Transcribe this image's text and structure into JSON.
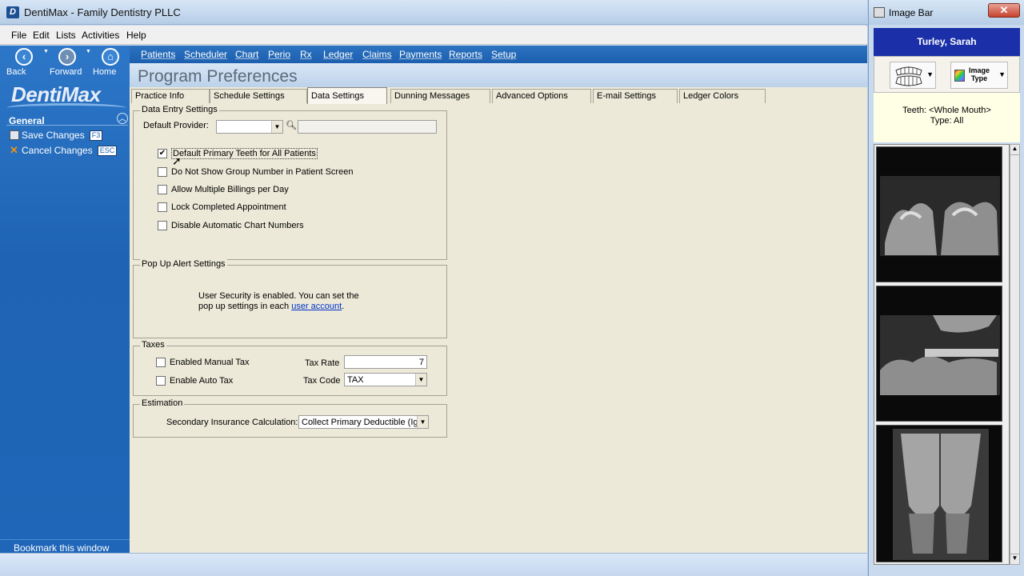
{
  "window": {
    "title": "DentiMax - Family Dentistry PLLC",
    "icon_letter": "D"
  },
  "menu": [
    "File",
    "Edit",
    "Lists",
    "Activities",
    "Help"
  ],
  "navbuttons": {
    "back": "Back",
    "forward": "Forward",
    "home": "Home"
  },
  "logo": "DentiMax",
  "sidebar": {
    "section": "General",
    "save_label": "Save Changes",
    "save_key": "F3",
    "cancel_label": "Cancel Changes",
    "cancel_key": "ESC",
    "bookmark": "Bookmark this window"
  },
  "modules": [
    "Patients",
    "Scheduler",
    "Chart",
    "Perio",
    "Rx",
    "Ledger",
    "Claims",
    "Payments",
    "Reports",
    "Setup"
  ],
  "page_title": "Program Preferences",
  "tabs": [
    "Practice Info",
    "Schedule Settings",
    "Data Settings",
    "Dunning Messages",
    "Advanced Options",
    "E-mail Settings",
    "Ledger Colors"
  ],
  "data_entry": {
    "legend": "Data Entry Settings",
    "default_provider_label": "Default Provider:",
    "default_provider_value": "",
    "checkboxes": [
      {
        "label": "Default Primary Teeth for All Patients",
        "checked": true
      },
      {
        "label": "Do Not Show Group Number in Patient Screen",
        "checked": false
      },
      {
        "label": "Allow Multiple Billings per Day",
        "checked": false
      },
      {
        "label": "Lock Completed Appointment",
        "checked": false
      },
      {
        "label": "Disable Automatic Chart Numbers",
        "checked": false
      }
    ]
  },
  "popup": {
    "legend": "Pop Up Alert Settings",
    "text1": "User Security is enabled.  You can set the",
    "text2": "pop up settings in each",
    "link": "user account",
    "text3": "."
  },
  "taxes": {
    "legend": "Taxes",
    "manual_tax": "Enabled Manual Tax",
    "auto_tax": "Enable Auto Tax",
    "rate_label": "Tax Rate",
    "rate_value": "7",
    "code_label": "Tax Code",
    "code_value": "TAX"
  },
  "estimation": {
    "legend": "Estimation",
    "label": "Secondary Insurance Calculation:",
    "value": "Collect Primary Deductible (Igr"
  },
  "image_bar": {
    "title": "Image Bar",
    "close": "✕",
    "patient": "Turley, Sarah",
    "image_type_label": "Image Type",
    "teeth": "Teeth: <Whole Mouth>",
    "type": "Type: All"
  },
  "colors": {
    "nav_blue": "#1f64b4",
    "patient_header": "#1a2fa8",
    "panel_bg": "#ece9d8"
  }
}
